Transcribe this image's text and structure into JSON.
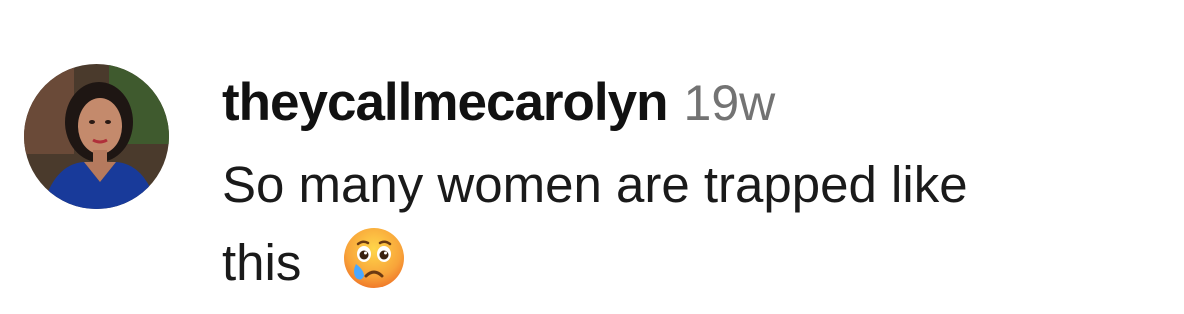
{
  "comment": {
    "username": "theycallmecarolyn",
    "timestamp": "19w",
    "text_line1": "So many women are trapped like",
    "text_line2": "this",
    "emoji": "crying-face-emoji"
  },
  "colors": {
    "username": "#111111",
    "timestamp": "#737373",
    "text": "#1a1a1a",
    "background": "#ffffff"
  }
}
